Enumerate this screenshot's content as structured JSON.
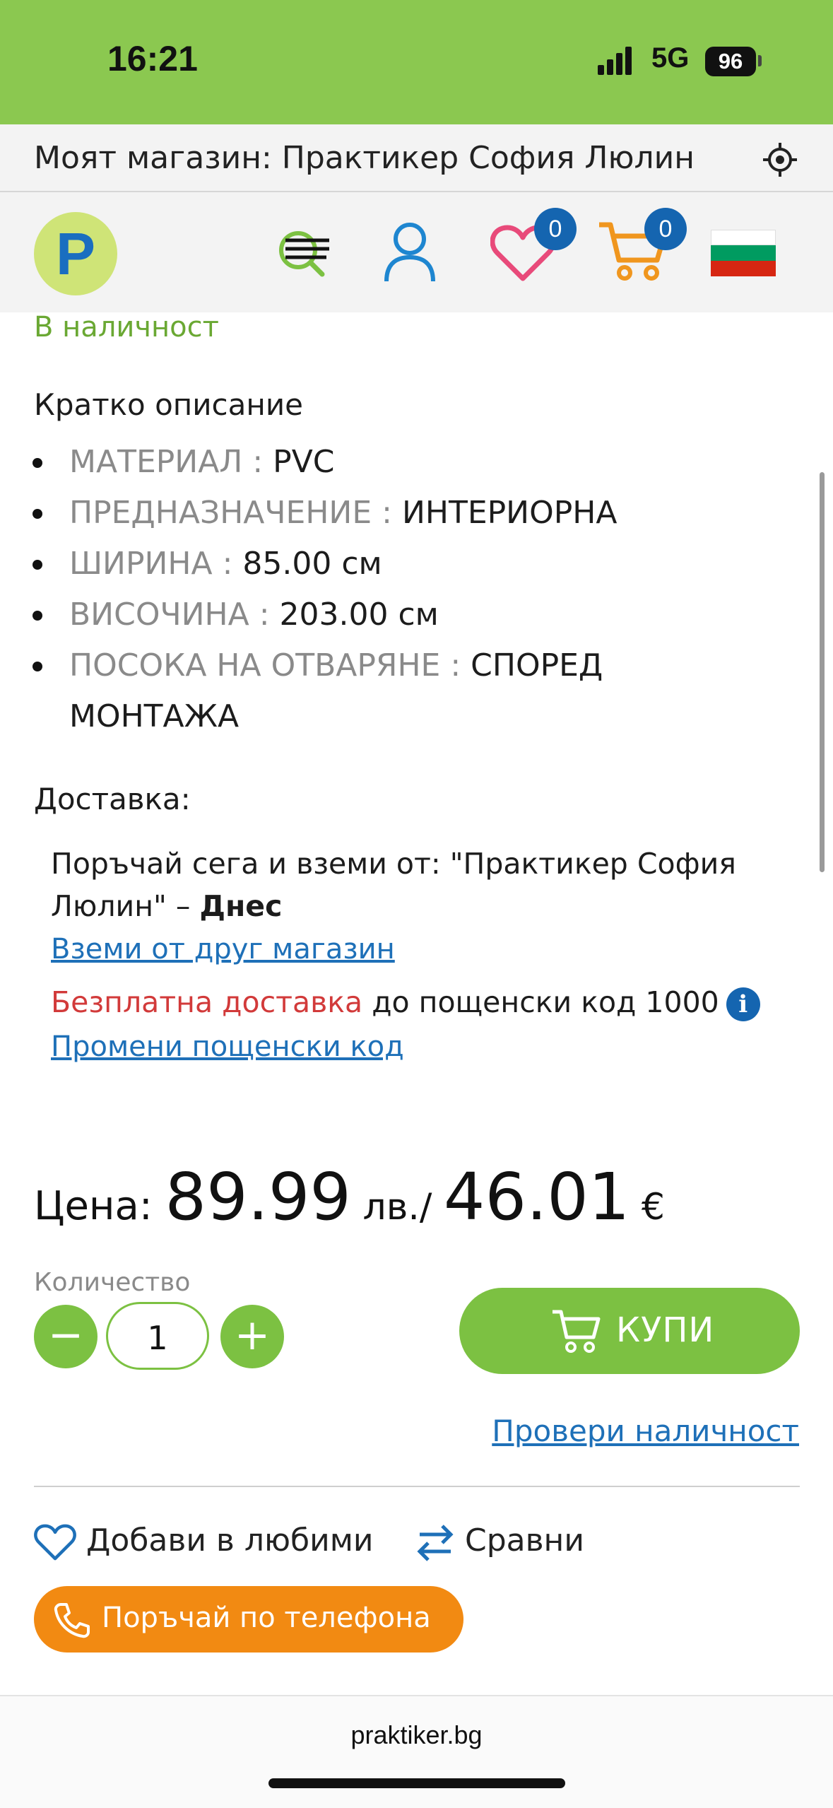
{
  "status_bar": {
    "time": "16:21",
    "network": "5G",
    "battery": "96"
  },
  "store_bar": {
    "text": "Моят магазин: Практикер София Люлин"
  },
  "header": {
    "logo_letter": "P",
    "favorites_count": "0",
    "cart_count": "0",
    "colors": {
      "brand_green": "#8bc850",
      "badge_blue": "#1565b0",
      "heart": "#e84a7a",
      "cart": "#f0961e"
    }
  },
  "product": {
    "availability": "В наличност",
    "short_description_title": "Кратко описание",
    "specs": [
      {
        "key": "МАТЕРИАЛ : ",
        "value": "PVC"
      },
      {
        "key": "ПРЕДНАЗНАЧЕНИЕ : ",
        "value": "ИНТЕРИОРНА"
      },
      {
        "key": "ШИРИНА : ",
        "value": "85.00 см"
      },
      {
        "key": "ВИСОЧИНА : ",
        "value": "203.00 см"
      },
      {
        "key": "ПОСОКА НА ОТВАРЯНЕ : ",
        "value": "СПОРЕД МОНТАЖА"
      }
    ]
  },
  "delivery": {
    "title": "Доставка:",
    "pickup_text": "Поръчай сега и вземи от: \"Практикер София Люлин\" – ",
    "pickup_when": "Днес",
    "other_store_link": "Вземи от друг магазин",
    "free_delivery": "Безплатна доставка",
    "free_delivery_rest": " до пощенски код 1000",
    "info_glyph": "i",
    "change_postcode_link": "Промени пощенски код"
  },
  "price": {
    "label": "Цена: ",
    "bgn": "89.99",
    "bgn_unit": " лв./ ",
    "eur": "46.01",
    "eur_unit": " €"
  },
  "quantity": {
    "label": "Количество",
    "value": "1",
    "minus": "−",
    "plus": "+"
  },
  "actions": {
    "buy": "КУПИ",
    "check_availability": "Провери наличност",
    "add_to_favorites": "Добави в любими",
    "compare": "Сравни",
    "order_by_phone": "Поръчай по телефона"
  },
  "browser": {
    "url": "praktiker.bg"
  }
}
